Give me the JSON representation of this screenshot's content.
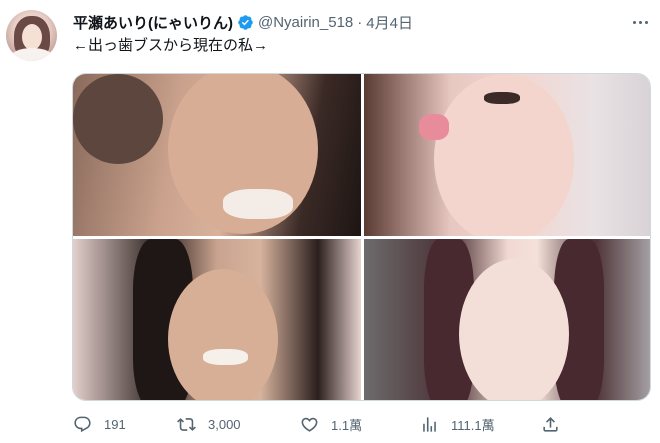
{
  "tweet": {
    "display_name": "平瀬あいり(にゃいりん)",
    "handle": "@Nyairin_518",
    "separator": "·",
    "date": "4月4日",
    "text": "←出っ歯ブスから現在の私→",
    "avatar": "profile-avatar",
    "media": [
      {
        "name": "photo-top-left"
      },
      {
        "name": "photo-top-right"
      },
      {
        "name": "photo-bottom-left"
      },
      {
        "name": "photo-bottom-right"
      }
    ]
  },
  "actions": {
    "reply": {
      "icon": "reply-icon",
      "count": "191"
    },
    "retweet": {
      "icon": "retweet-icon",
      "count": "3,000"
    },
    "like": {
      "icon": "heart-icon",
      "count": "1.1萬"
    },
    "views": {
      "icon": "views-icon",
      "count": "111.1萬"
    },
    "share": {
      "icon": "share-icon"
    }
  },
  "colors": {
    "verified_badge": "#1d9bf0",
    "secondary_text": "#536471",
    "primary_text": "#0f1419",
    "border": "#cfd9de"
  }
}
